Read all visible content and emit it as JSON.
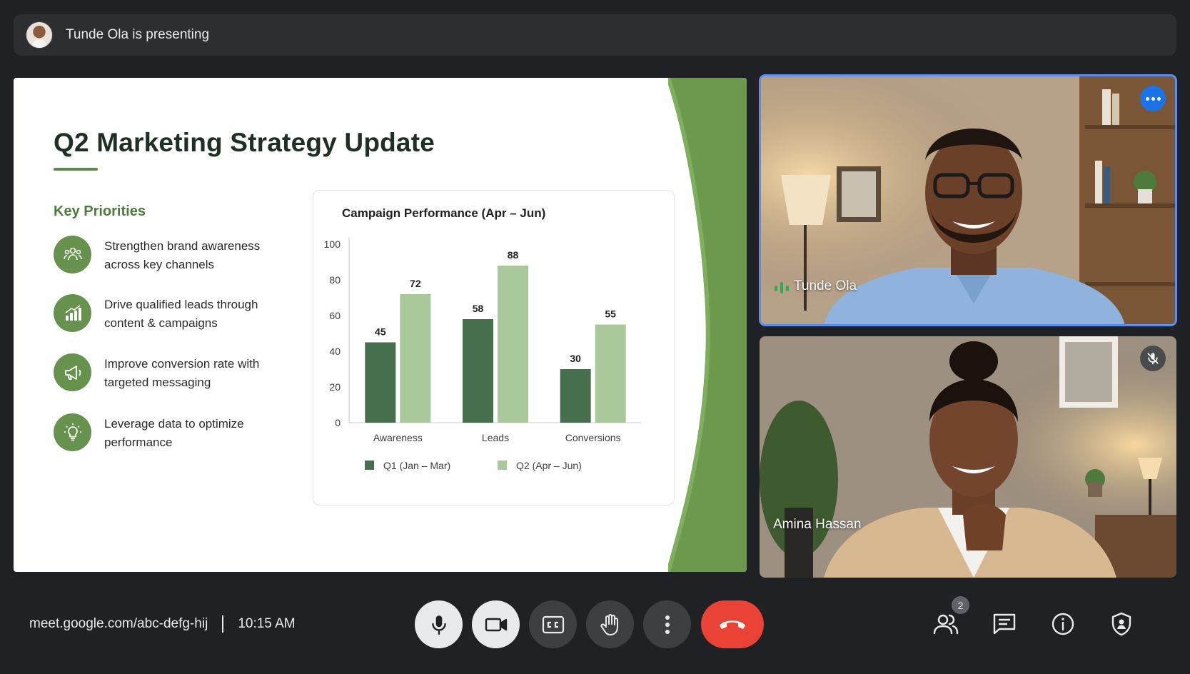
{
  "topbar": {
    "presenting_text": "Tunde Ola is presenting"
  },
  "slide": {
    "title": "Q2 Marketing Strategy Update",
    "priorities_heading": "Key Priorities",
    "priorities": [
      {
        "icon": "group-icon",
        "text": "Strengthen brand awareness across key channels"
      },
      {
        "icon": "growth-chart-icon",
        "text": "Drive qualified leads through content & campaigns"
      },
      {
        "icon": "megaphone-icon",
        "text": "Improve conversion rate with targeted messaging"
      },
      {
        "icon": "lightbulb-icon",
        "text": "Leverage data to optimize performance"
      }
    ],
    "accent_color": "#67924e"
  },
  "chart_data": {
    "type": "bar",
    "title": "Campaign Performance (Apr – Jun)",
    "categories": [
      "Awareness",
      "Leads",
      "Conversions"
    ],
    "series": [
      {
        "name": "Q1 (Jan – Mar)",
        "values": [
          45,
          58,
          30
        ],
        "color": "#466f4e"
      },
      {
        "name": "Q2 (Apr – Jun)",
        "values": [
          72,
          88,
          55
        ],
        "color": "#a9c99b"
      }
    ],
    "yticks": [
      "0",
      "20",
      "40",
      "60",
      "80",
      "100"
    ],
    "ylim": [
      0,
      100
    ],
    "legend_position": "bottom",
    "grid": false
  },
  "participants": [
    {
      "name": "Tunde Ola",
      "active_speaker": true,
      "more_icon": "more-options-icon"
    },
    {
      "name": "Amina Hassan",
      "muted": true,
      "mic_icon": "mic-off-icon"
    }
  ],
  "meeting": {
    "url": "meet.google.com/abc-defg-hij",
    "time": "10:15 AM"
  },
  "controls": {
    "mic": "mic-icon",
    "camera": "camera-icon",
    "captions": "captions-icon",
    "raise_hand": "hand-icon",
    "more": "more-vert-icon",
    "end_call": "end-call-icon",
    "people_count": "2"
  },
  "colors": {
    "background": "#202124",
    "end_call": "#ea4335",
    "active_border": "#5b8def"
  }
}
